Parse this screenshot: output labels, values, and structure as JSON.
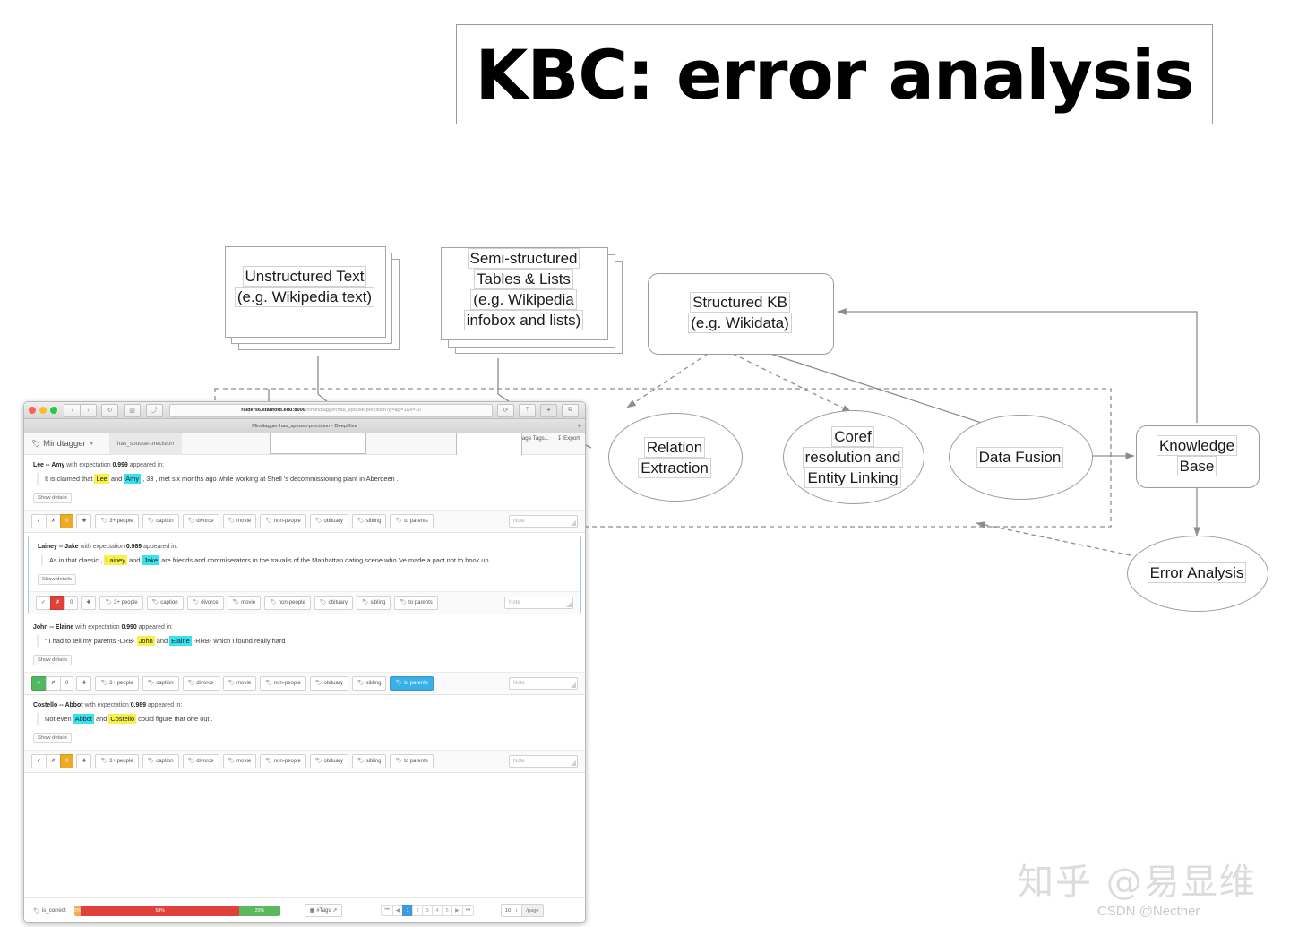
{
  "slide": {
    "title": "KBC: error analysis"
  },
  "diagram": {
    "nodes": {
      "unstructured_text": {
        "line1": "Unstructured Text",
        "line2": "(e.g. Wikipedia text)"
      },
      "semi_structured": {
        "line1": "Semi-structured",
        "line2": "Tables & Lists",
        "line3": "(e.g. Wikipedia",
        "line4": "infobox and lists)"
      },
      "structured_kb": {
        "line1": "Structured KB",
        "line2": "(e.g. Wikidata)"
      },
      "relation_extraction": {
        "line1": "Relation",
        "line2": "Extraction"
      },
      "coref": {
        "line1": "Coref",
        "line2": "resolution and",
        "line3": "Entity Linking"
      },
      "data_fusion": {
        "line1": "Data Fusion"
      },
      "knowledge_base": {
        "line1": "Knowledge",
        "line2": "Base"
      },
      "error_analysis": {
        "line1": "Error Analysis"
      }
    }
  },
  "browser": {
    "window_title": "Mindtagger has_spouse-precision - DeepDive",
    "url_host": "raiders6.stanford.edu:8000",
    "url_path": "/#/mindtagger/has_spouse-precision?g=&p=1&s=10",
    "nav": {
      "back": "‹",
      "forward": "›",
      "reload": "↻",
      "sidebar": "▥",
      "share": "⤴",
      "refresh_right": "⟳",
      "upload": "⤒",
      "shield": "✦",
      "tabs": "⧉",
      "newtab": "+"
    }
  },
  "app": {
    "brand": "Mindtagger",
    "brand_caret": "▾",
    "tab": "has_spouse-precision",
    "manage_tags": "Manage Tags...",
    "export": "Export",
    "manage_tags_icon": "gear-icon",
    "export_icon": "download-icon"
  },
  "items": [
    {
      "subject": "Lee",
      "separator": "--",
      "object": "Amy",
      "head_mid": "with expectation",
      "expectation": "0.999",
      "head_end": "appeared in:",
      "sentence_pre": "It is claimed that ",
      "hl1": "Lee",
      "sentence_mid": " and ",
      "hl2": "Amy",
      "sentence_post": " , 33 , met six months ago while working at Shell 's decommissioning plant in Aberdeen .",
      "hl1_color": "yellow",
      "hl2_color": "cyan",
      "show_details": "Show details",
      "state": "question",
      "active_tag": null,
      "note_placeholder": "Note",
      "selected": false
    },
    {
      "subject": "Lainey",
      "separator": "--",
      "object": "Jake",
      "head_mid": "with expectation",
      "expectation": "0.989",
      "head_end": "appeared in:",
      "sentence_pre": "As in that classic , ",
      "hl1": "Lainey",
      "sentence_mid": " and ",
      "hl2": "Jake",
      "sentence_post": " are friends and commiserators in the travails of the Manhattan dating scene who 've made a pact not to hook up .",
      "hl1_color": "yellow",
      "hl2_color": "cyan",
      "show_details": "Show details",
      "state": "reject",
      "active_tag": null,
      "note_placeholder": "Note",
      "selected": true
    },
    {
      "subject": "John",
      "separator": "--",
      "object": "Elaine",
      "head_mid": "with expectation",
      "expectation": "0.990",
      "head_end": "appeared in:",
      "sentence_pre": "“ I had to tell my parents -LRB- ",
      "hl1": "John",
      "sentence_mid": " and ",
      "hl2": "Elaine",
      "sentence_post": " -RRB- which I found really hard .",
      "hl1_color": "yellow",
      "hl2_color": "cyan",
      "show_details": "Show details",
      "state": "accept",
      "active_tag": "to parents",
      "note_placeholder": "Note",
      "selected": false
    },
    {
      "subject": "Costello",
      "separator": "--",
      "object": "Abbot",
      "head_mid": "with expectation",
      "expectation": "0.989",
      "head_end": "appeared in:",
      "sentence_pre": "Not even ",
      "hl1": "Abbot",
      "sentence_mid": " and ",
      "hl2": "Costello",
      "sentence_post": " could figure that one out .",
      "hl1_color": "cyan",
      "hl2_color": "yellow",
      "show_details": "Show details",
      "state": "question",
      "active_tag": null,
      "note_placeholder": "Note",
      "selected": false
    }
  ],
  "toolbar": {
    "accept": "✓",
    "reject": "✗",
    "question": "0",
    "plus": "✚",
    "tags": [
      "3+ people",
      "caption",
      "divorce",
      "movie",
      "non-people",
      "obituary",
      "sibling",
      "to parents"
    ]
  },
  "footer": {
    "stat_label": "is_correct",
    "progress": [
      {
        "label": "2%",
        "pct": 2,
        "color": "#f0ad4e"
      },
      {
        "label": "58%",
        "pct": 78,
        "color": "#e0413b"
      },
      {
        "label": "20%",
        "pct": 20,
        "color": "#5cb85c"
      }
    ],
    "tags_button": "#Tags",
    "pager": [
      "⏮",
      "◀",
      "1",
      "2",
      "3",
      "4",
      "5",
      "▶",
      "⏭"
    ],
    "pager_active": "1",
    "per_page_value": "10",
    "per_page_caret": "↕",
    "per_page_suffix": "/page"
  },
  "watermarks": {
    "zhihu": "知乎 @易显维",
    "csdn": "CSDN @Necther"
  }
}
